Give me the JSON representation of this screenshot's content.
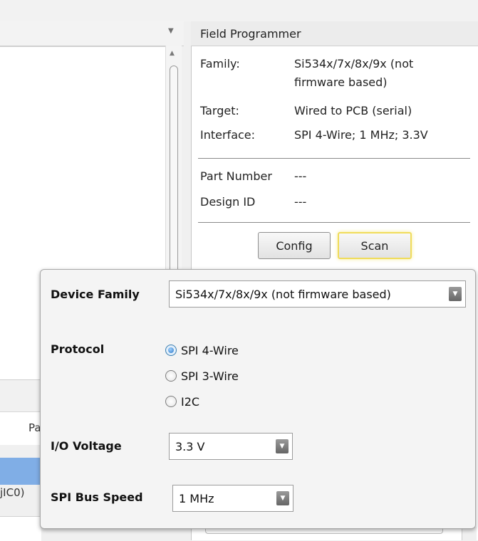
{
  "field_programmer": {
    "title": "Field Programmer",
    "rows": [
      {
        "label": "Family:",
        "value_line1": "Si534x/7x/8x/9x (not",
        "value_line2": "firmware based)"
      },
      {
        "label": "Target:",
        "value": "Wired to PCB (serial)"
      },
      {
        "label": "Interface:",
        "value": "SPI 4-Wire; 1 MHz; 3.3V"
      }
    ],
    "part_number": {
      "label": "Part Number",
      "value": "---"
    },
    "design_id": {
      "label": "Design ID",
      "value": "---"
    },
    "config_label": "Config",
    "scan_label": "Scan"
  },
  "background": {
    "left_tab_fragment": "Pa",
    "left_row_fragment": "jIC0)"
  },
  "popup": {
    "device_family": {
      "label": "Device Family",
      "value": "Si534x/7x/8x/9x (not firmware based)"
    },
    "protocol": {
      "label": "Protocol",
      "options": [
        "SPI 4-Wire",
        "SPI 3-Wire",
        "I2C"
      ],
      "selected": "SPI 4-Wire"
    },
    "io_voltage": {
      "label": "I/O Voltage",
      "value": "3.3 V"
    },
    "spi_bus_speed": {
      "label": "SPI Bus Speed",
      "value": "1 MHz"
    }
  },
  "colors": {
    "selection_blue": "#80aee6",
    "scan_highlight": "#f0dc5a",
    "radio_selected": "#2f78c4"
  }
}
